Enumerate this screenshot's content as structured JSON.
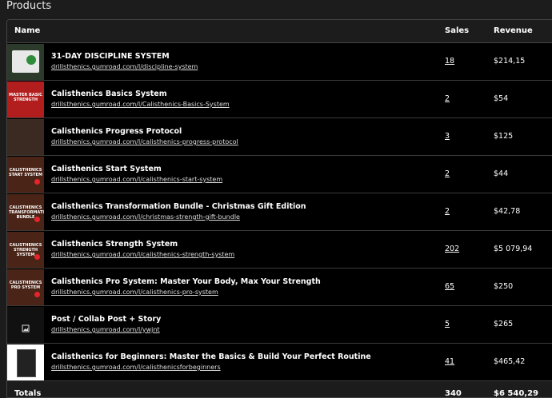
{
  "section_title": "Products",
  "columns": {
    "name": "Name",
    "sales": "Sales",
    "revenue": "Revenue"
  },
  "products": [
    {
      "name": "31-DAY DISCIPLINE SYSTEM",
      "url": "drillsthenics.gumroad.com/l/discipline-system",
      "sales": "18",
      "revenue": "$214,15",
      "thumb_text": "",
      "thumb_color": "#2b3a2a"
    },
    {
      "name": "Calisthenics Basics System",
      "url": "drillsthenics.gumroad.com/l/Calisthenics-Basics-System",
      "sales": "2",
      "revenue": "$54",
      "thumb_text": "MASTER BASIC STRENGTH",
      "thumb_color": "#b21d1d"
    },
    {
      "name": "Calisthenics Progress Protocol",
      "url": "drillsthenics.gumroad.com/l/calisthenics-progress-protocol",
      "sales": "3",
      "revenue": "$125",
      "thumb_text": "",
      "thumb_color": "#3a2a22"
    },
    {
      "name": "Calisthenics Start System",
      "url": "drillsthenics.gumroad.com/l/calisthenics-start-system",
      "sales": "2",
      "revenue": "$44",
      "thumb_text": "CALISTHENICS START SYSTEM",
      "thumb_color": "#4a2416"
    },
    {
      "name": "Calisthenics Transformation Bundle - Christmas Gift Edition",
      "url": "drillsthenics.gumroad.com/l/christmas-strength-gift-bundle",
      "sales": "2",
      "revenue": "$42,78",
      "thumb_text": "CALISTHENICS TRANSFORMATION BUNDLE",
      "thumb_color": "#4a2416"
    },
    {
      "name": "Calisthenics Strength System",
      "url": "drillsthenics.gumroad.com/l/calisthenics-strength-system",
      "sales": "202",
      "revenue": "$5 079,94",
      "thumb_text": "CALISTHENICS STRENGTH SYSTEM",
      "thumb_color": "#4a2416"
    },
    {
      "name": "Calisthenics Pro System: Master Your Body, Max Your Strength",
      "url": "drillsthenics.gumroad.com/l/calisthenics-pro-system",
      "sales": "65",
      "revenue": "$250",
      "thumb_text": "CALISTHENICS PRO SYSTEM",
      "thumb_color": "#4a2416"
    },
    {
      "name": "Post / Collab Post + Story",
      "url": "drillsthenics.gumroad.com/l/ywjnt",
      "sales": "5",
      "revenue": "$265",
      "thumb_text": "",
      "thumb_color": "#111111"
    },
    {
      "name": "Calisthenics for Beginners: Master the Basics & Build Your Perfect Routine",
      "url": "drillsthenics.gumroad.com/l/calisthenicsforbeginners",
      "sales": "41",
      "revenue": "$465,42",
      "thumb_text": "",
      "thumb_color": "#ffffff"
    }
  ],
  "totals": {
    "label": "Totals",
    "sales": "340",
    "revenue": "$6 540,29"
  }
}
